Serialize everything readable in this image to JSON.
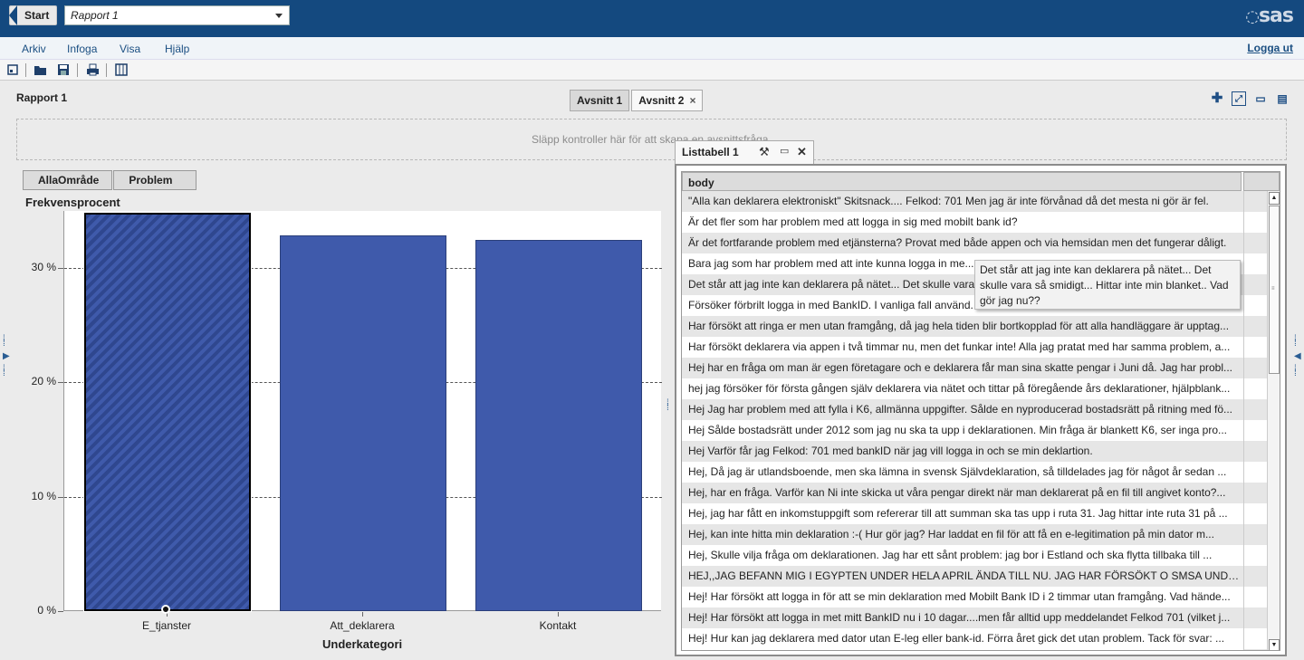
{
  "topbar": {
    "start_label": "Start",
    "report_select_value": "Rapport 1",
    "logo_text": "sas"
  },
  "menu": {
    "items": [
      "Arkiv",
      "Infoga",
      "Visa",
      "Hjälp"
    ],
    "logout": "Logga ut"
  },
  "toolbar": {
    "icons": [
      "new-report-icon",
      "open-icon",
      "save-icon",
      "print-icon",
      "layout-icon"
    ]
  },
  "report": {
    "title": "Rapport 1",
    "tabs": [
      {
        "label": "Avsnitt 1",
        "active": false
      },
      {
        "label": "Avsnitt 2",
        "active": true,
        "close": "×"
      }
    ],
    "right_tools": [
      "add-icon",
      "fullscreen-icon",
      "window-icon",
      "collapse-icon"
    ],
    "dropzone_text": "Släpp kontroller här för att skapa en avsnittsfråga"
  },
  "chart": {
    "breadcrumbs": [
      "AllaOmråde",
      "Problem"
    ],
    "selected_category": "E_tjanster",
    "bar_color": "#3f5aab"
  },
  "chart_data": {
    "type": "bar",
    "categories": [
      "E_tjanster",
      "Att_deklarera",
      "Kontakt"
    ],
    "values": [
      34.8,
      32.8,
      32.4
    ],
    "xlabel": "Underkategori",
    "ylabel": "Frekvensprocent",
    "yticks": [
      "0 %",
      "10 %",
      "20 %",
      "30 %"
    ],
    "ylim": [
      0,
      35
    ],
    "grid": true
  },
  "listtable": {
    "title": "Listtabell 1",
    "column_header": "body",
    "rows": [
      "\"Alla kan deklarera elektroniskt\" Skitsnack.... Felkod: 701 Men jag är inte förvånad då det mesta ni gör är fel.",
      "Är det fler som har problem med att logga in sig med mobilt bank id?",
      "Är det fortfarande problem med etjänsterna? Provat med både appen och via hemsidan men det fungerar dåligt.",
      "Bara jag som har problem med att inte kunna logga in me...",
      "Det står att jag inte kan deklarera på nätet... Det skulle vara...",
      "Försöker förbrilt logga in med BankID. I vanliga fall använd...",
      "Har försökt att ringa er men utan framgång, då jag hela tiden blir bortkopplad för att alla handläggare är upptag...",
      "Har försökt deklarera via appen i två timmar nu, men det funkar inte! Alla jag pratat med har samma problem, a...",
      "Hej har en fråga om man är egen företagare och e deklarera får man sina skatte pengar i Juni då. Jag har probl...",
      "hej jag försöker för första gången själv deklarera via nätet och tittar på föregående års deklarationer, hjälpblank...",
      "Hej Jag har problem med att fylla i K6, allmänna uppgifter. Sålde en nyproducerad bostadsrätt på ritning med fö...",
      "Hej Sålde bostadsrätt under 2012 som jag nu ska ta upp i deklarationen. Min fråga är blankett K6, ser inga pro...",
      "Hej Varför får jag Felkod: 701 med bankID när jag vill logga in och se min deklartion.",
      "Hej, Då jag är utlandsboende, men ska lämna in svensk Självdeklaration, så tilldelades jag för något år sedan ...",
      "Hej, har en fråga. Varför kan Ni inte skicka ut våra pengar direkt när man deklarerat på en fil till angivet konto?...",
      "Hej, jag har fått en inkomstuppgift som refererar till att summan ska tas upp i ruta 31. Jag hittar inte ruta 31 på ...",
      "Hej, kan inte hitta min deklaration :-( Hur gör jag? Har laddat en fil för att få en e-legitimation på min dator m...",
      "Hej, Skulle vilja fråga om deklarationen. Jag har ett sånt problem: jag bor i Estland och ska flytta tillbaka till ...",
      "HEJ,,JAG BEFANN MIG I EGYPTEN UNDER HELA APRIL ÄNDA TILL NU. JAG HAR FÖRSÖKT O SMSA UNDER...",
      "Hej! Har försökt att logga in för att se min deklaration med Mobilt Bank ID i 2 timmar utan framgång. Vad hände...",
      "Hej! Har försökt att logga in met mitt BankID nu i 10 dagar....men får alltid upp meddelandet Felkod 701 (vilket j...",
      "Hej! Hur kan jag deklarera med dator utan E-leg eller bank-id. Förra året gick det utan problem. Tack för svar: ..."
    ],
    "tooltip": "Det står att jag inte kan deklarera på nätet... Det skulle vara så smidigt... Hittar inte min blanket.. Vad gör jag nu??"
  }
}
